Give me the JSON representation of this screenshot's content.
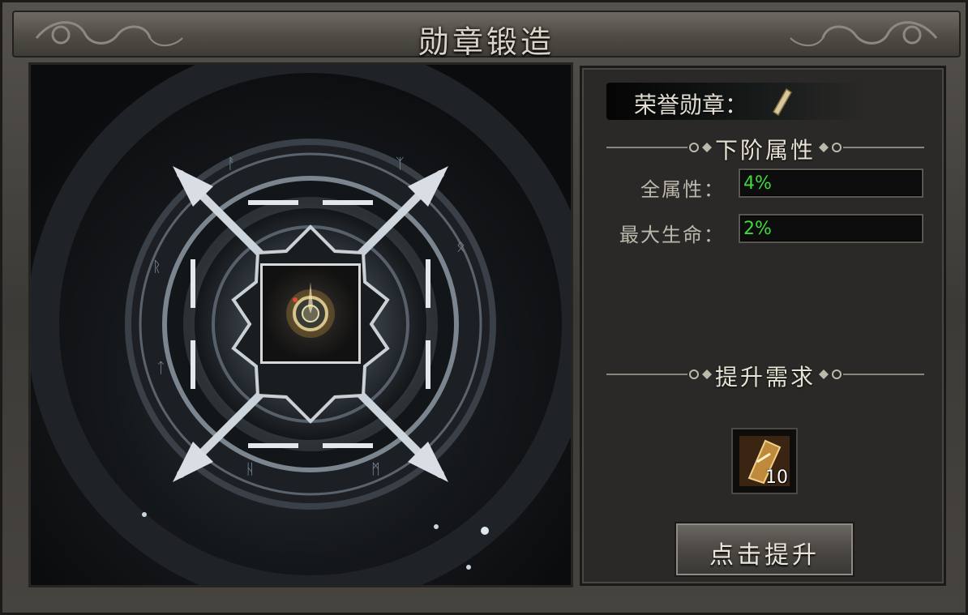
{
  "window": {
    "title": "勋章锻造"
  },
  "honor": {
    "label": "荣誉勋章："
  },
  "lower_tier": {
    "title": "下阶属性",
    "stats": [
      {
        "label": "全属性：",
        "value": "4%"
      },
      {
        "label": "最大生命：",
        "value": "2%"
      }
    ]
  },
  "requirement": {
    "title": "提升需求",
    "item_count": "10"
  },
  "actions": {
    "upgrade_label": "点击提升"
  },
  "colors": {
    "stat_value": "#3fd93f",
    "title_text": "#d9d4c7"
  },
  "icons": {
    "honor_medal": "medal-icon",
    "requirement_item": "honor-token-icon",
    "forge_slot_medal": "medal-gem-icon"
  }
}
